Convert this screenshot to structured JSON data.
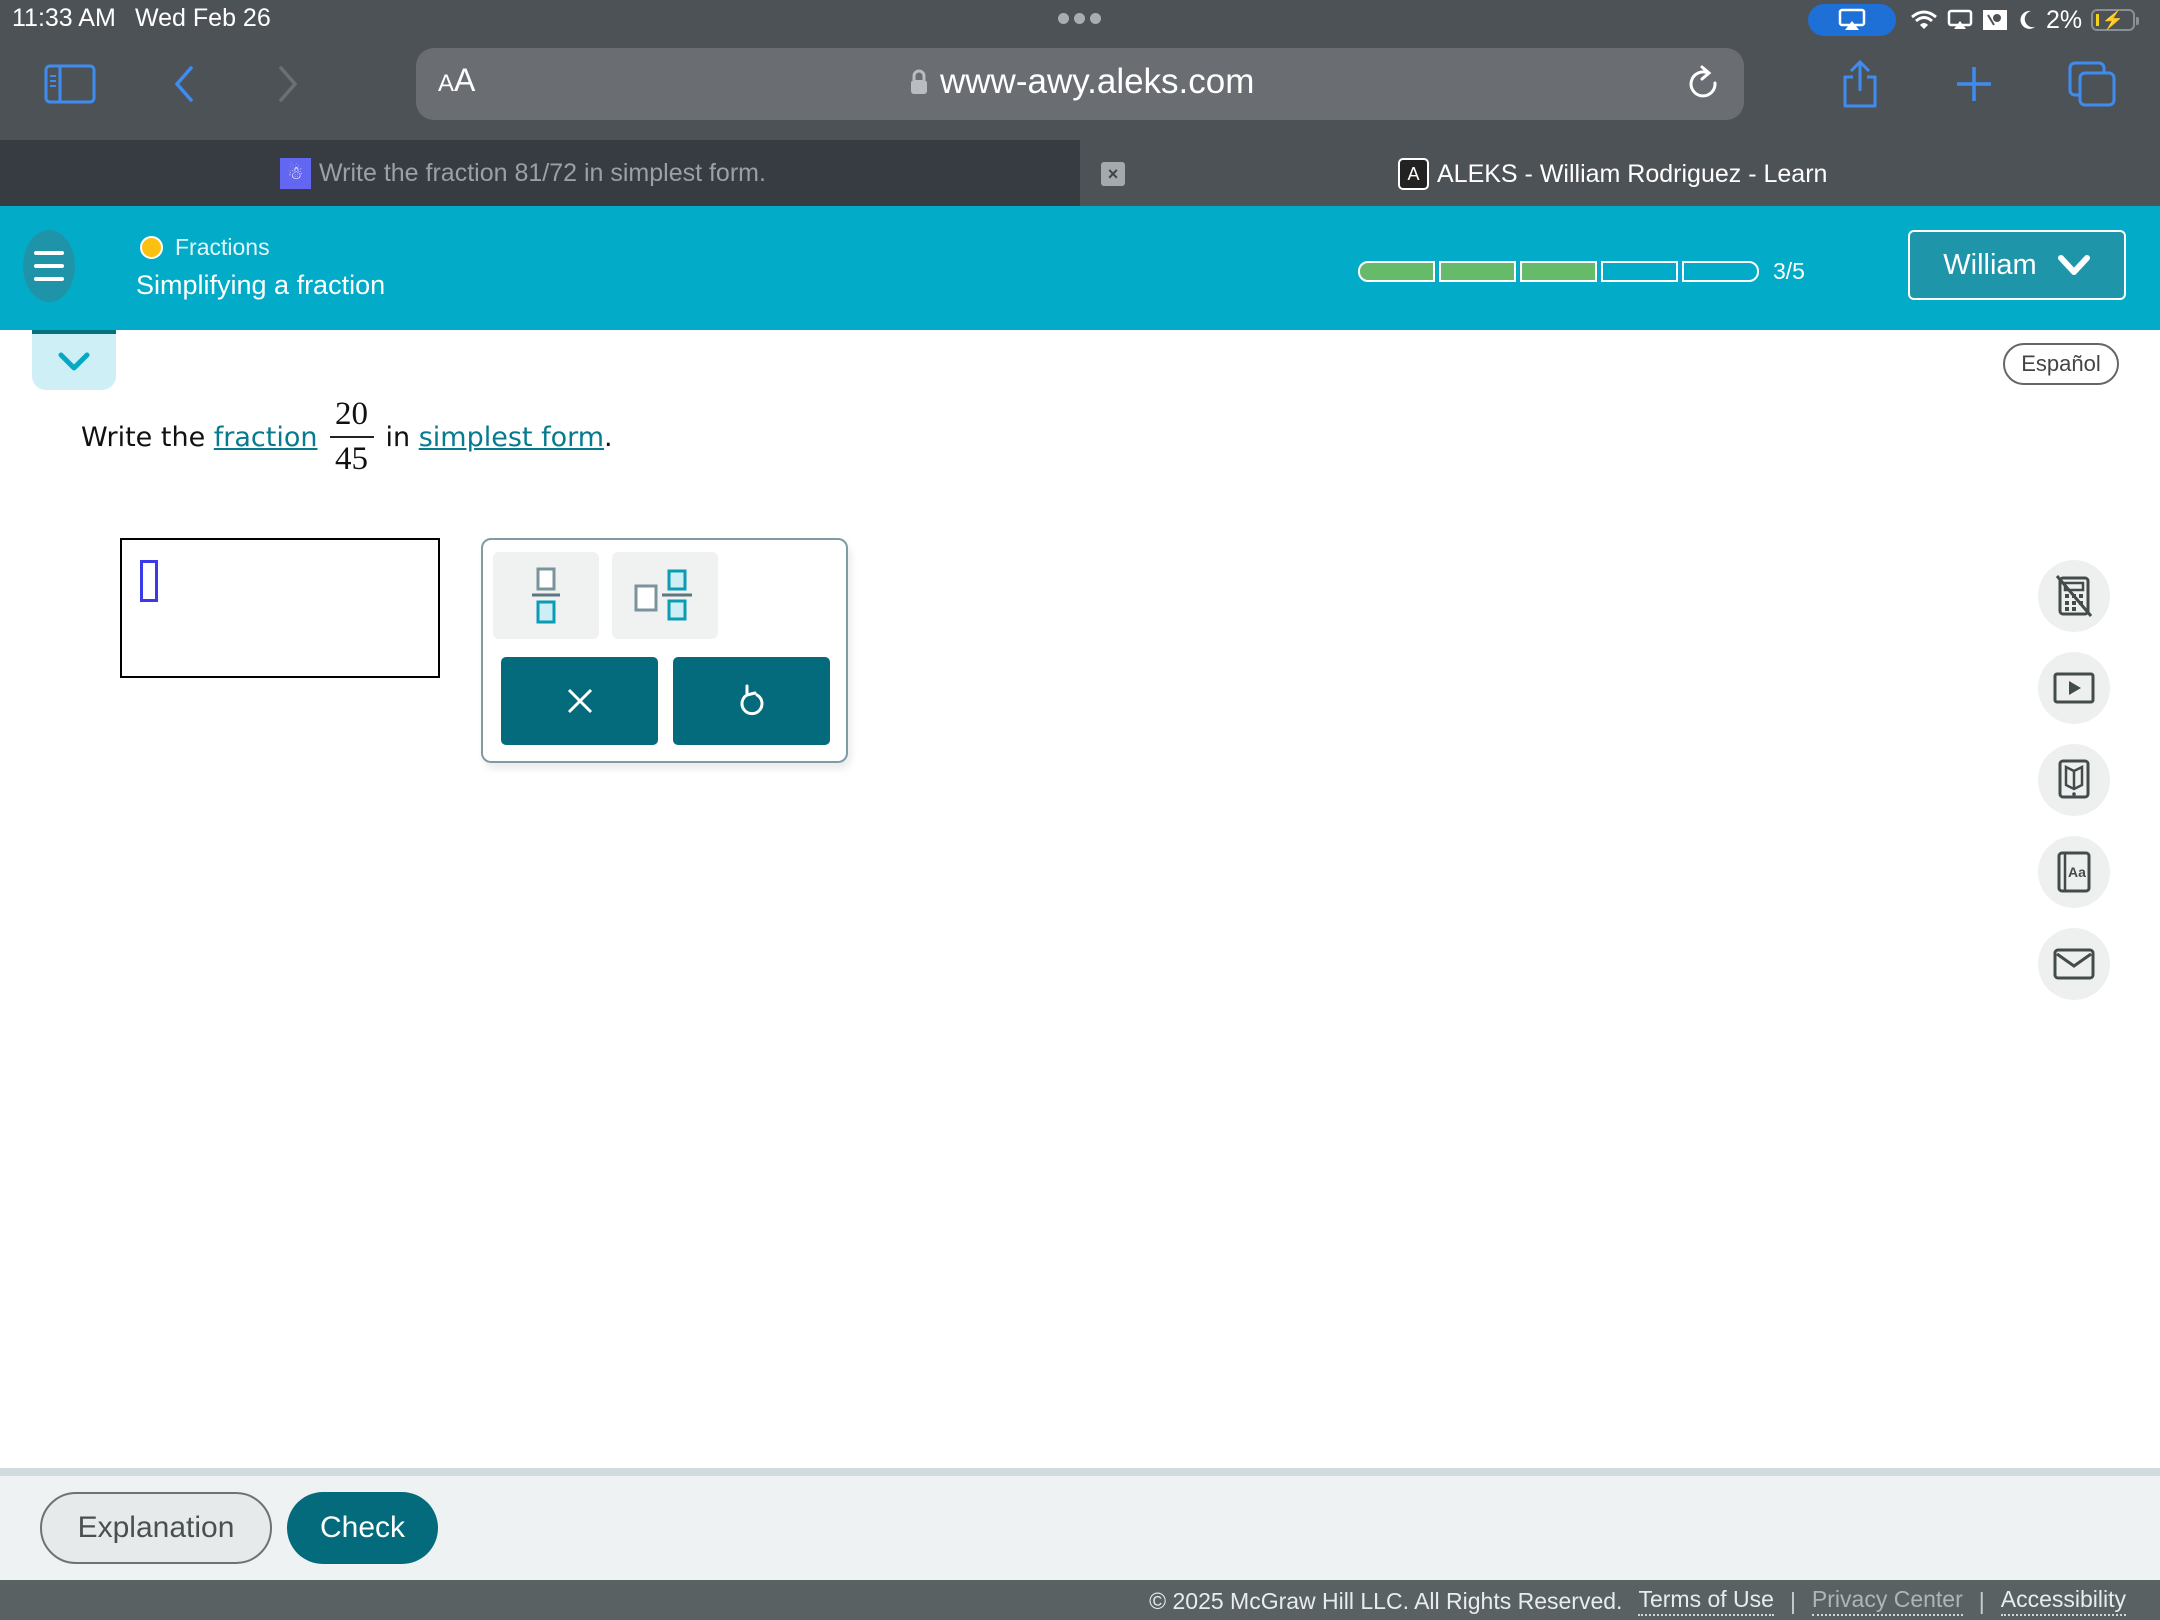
{
  "status_bar": {
    "time": "11:33 AM",
    "date": "Wed Feb 26",
    "battery_percent": "2%",
    "icons": [
      "airplay-icon",
      "wifi-icon",
      "screen-mirror-icon",
      "portrait-lock-icon",
      "moon-icon",
      "battery-charging-icon"
    ]
  },
  "browser": {
    "text_size_label": "AA",
    "url": "www-awy.aleks.com",
    "toolbar_icons": [
      "sidebar-icon",
      "back-icon",
      "forward-icon",
      "reload-icon",
      "share-icon",
      "new-tab-icon",
      "tabs-icon"
    ],
    "tabs": [
      {
        "title": "Write the fraction 81/72 in simplest form.",
        "active": true
      },
      {
        "title": "ALEKS - William Rodriguez - Learn",
        "active": false,
        "favicon": "A"
      }
    ],
    "tab_close_label": "×"
  },
  "header": {
    "topic": "Fractions",
    "subtopic": "Simplifying a fraction",
    "progress": {
      "completed": 3,
      "total": 5,
      "label": "3/5"
    },
    "user_label": "William",
    "colors": {
      "header_bg": "#02abc8",
      "progress_fill": "#66bb6a",
      "topic_dot": "#fdc00f"
    }
  },
  "language_button": "Español",
  "question": {
    "prefix": "Write the",
    "link1": "fraction",
    "numerator": "20",
    "denominator": "45",
    "middle": "in",
    "link2": "simplest form",
    "suffix": "."
  },
  "answer": {
    "value": ""
  },
  "keypad": {
    "templates": [
      "fraction-template",
      "mixed-number-template"
    ],
    "clear_label": "×",
    "undo_label": "↺"
  },
  "tools": [
    "calculator-disabled-icon",
    "video-icon",
    "ebook-icon",
    "dictionary-icon",
    "message-icon"
  ],
  "actions": {
    "explanation_label": "Explanation",
    "check_label": "Check"
  },
  "footer": {
    "copyright": "© 2025 McGraw Hill LLC. All Rights Reserved.",
    "links": [
      "Terms of Use",
      "Privacy Center",
      "Accessibility"
    ],
    "separator": "|"
  }
}
